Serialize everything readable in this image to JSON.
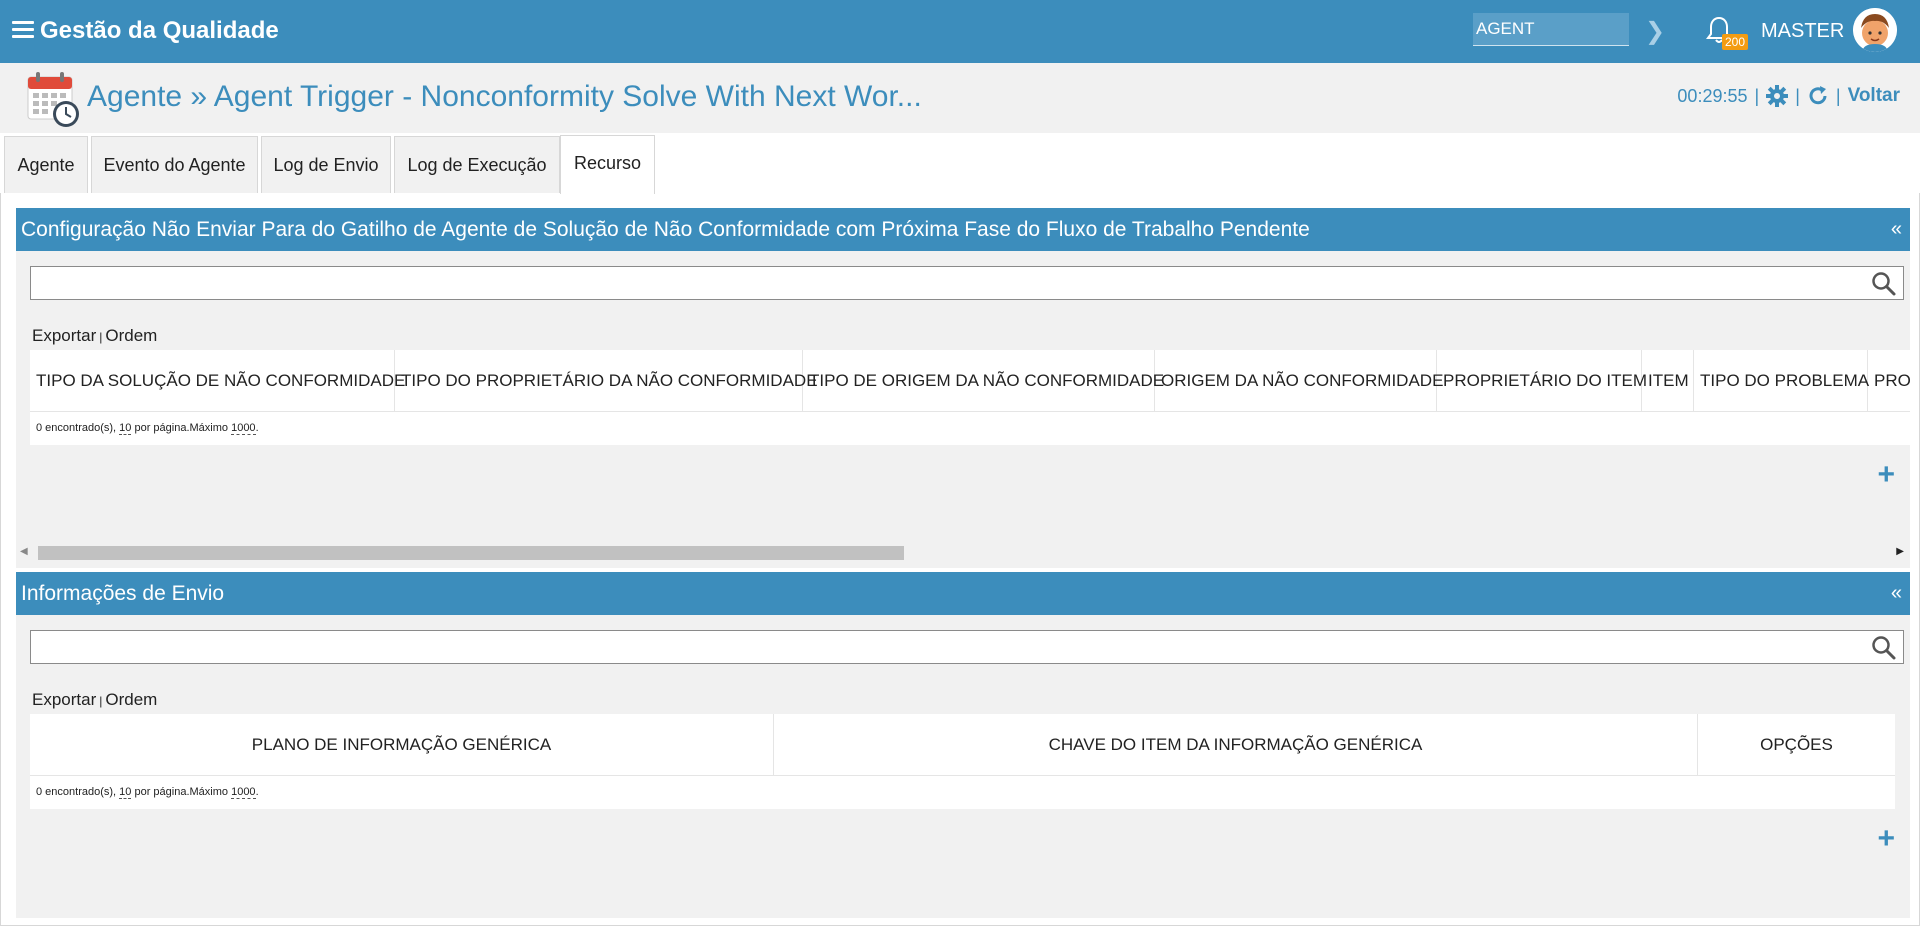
{
  "header": {
    "app_title": "Gestão da Qualidade",
    "search_value": "AGENT",
    "notification_count": "200",
    "user_name": "MASTER"
  },
  "titlebar": {
    "title": "Agente » Agent Trigger - Nonconformity Solve With Next Wor...",
    "timer": "00:29:55",
    "back_label": "Voltar"
  },
  "tabs": [
    {
      "label": "Agente",
      "active": false
    },
    {
      "label": "Evento do Agente",
      "active": false
    },
    {
      "label": "Log de Envio",
      "active": false
    },
    {
      "label": "Log de Execução",
      "active": false
    },
    {
      "label": "Recurso",
      "active": true
    }
  ],
  "panel1": {
    "title": "Configuração Não Enviar Para do Gatilho de Agente de Solução de Não Conformidade com Próxima Fase do Fluxo de Trabalho Pendente",
    "collapse": "«",
    "export_label": "Exportar",
    "order_label": "Ordem",
    "columns": [
      "TIPO DA SOLUÇÃO DE NÃO CONFORMIDADE",
      "TIPO DO PROPRIETÁRIO DA NÃO CONFORMIDADE",
      "TIPO DE ORIGEM DA NÃO CONFORMIDADE",
      "ORIGEM DA NÃO CONFORMIDADE",
      "PROPRIETÁRIO DO ITEM",
      "ITEM",
      "TIPO DO PROBLEMA",
      "PROI"
    ],
    "footer_found": "0 encontrado(s), ",
    "footer_per_page_num": "10",
    "footer_per_page_txt": " por página.Máximo ",
    "footer_max": "1000",
    "footer_end": "."
  },
  "panel2": {
    "title": "Informações de Envio",
    "collapse": "«",
    "export_label": "Exportar",
    "order_label": "Ordem",
    "columns": [
      "PLANO DE INFORMAÇÃO GENÉRICA",
      "CHAVE DO ITEM DA INFORMAÇÃO GENÉRICA",
      "OPÇÕES"
    ],
    "footer_found": "0 encontrado(s), ",
    "footer_per_page_num": "10",
    "footer_per_page_txt": " por página.Máximo ",
    "footer_max": "1000",
    "footer_end": "."
  },
  "colors": {
    "primary": "#3c8dbc",
    "badge": "#f39c12",
    "background": "#f1f1f1"
  }
}
